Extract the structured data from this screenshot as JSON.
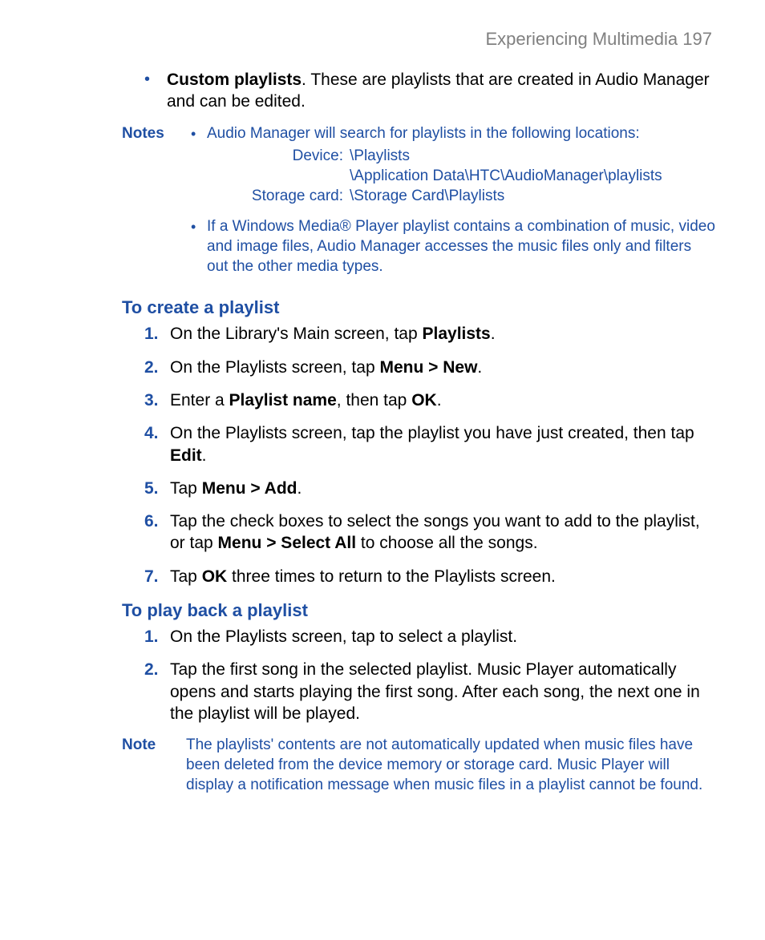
{
  "header": {
    "title": "Experiencing Multimedia  197"
  },
  "intro_bullet": {
    "bold": "Custom playlists",
    "rest": ". These are playlists that are created in Audio Manager and can be edited."
  },
  "notes_label": "Notes",
  "notes": {
    "n1_lead": "Audio Manager will search for playlists in the following locations:",
    "loc": {
      "device_key": "Device:",
      "device_val1": "\\Playlists",
      "device_val2": "\\Application Data\\HTC\\AudioManager\\playlists",
      "card_key": "Storage card:",
      "card_val": "\\Storage Card\\Playlists"
    },
    "n2": "If a Windows Media® Player playlist contains a combination of music, video and image files, Audio Manager accesses the music files only and filters out the other media types."
  },
  "create": {
    "heading": "To create a playlist",
    "s1_a": "On the Library's Main screen, tap ",
    "s1_b": "Playlists",
    "s1_c": ".",
    "s2_a": "On the Playlists screen, tap ",
    "s2_b": "Menu > New",
    "s2_c": ".",
    "s3_a": "Enter a ",
    "s3_b": "Playlist name",
    "s3_c": ", then tap ",
    "s3_d": "OK",
    "s3_e": ".",
    "s4_a": "On the Playlists screen, tap the playlist you have just created, then tap ",
    "s4_b": "Edit",
    "s4_c": ".",
    "s5_a": "Tap ",
    "s5_b": "Menu > Add",
    "s5_c": ".",
    "s6_a": "Tap the check boxes to select the songs you want to add to the playlist, or tap ",
    "s6_b": "Menu > Select All",
    "s6_c": " to choose all the songs.",
    "s7_a": "Tap ",
    "s7_b": "OK",
    "s7_c": " three times to return to the Playlists screen."
  },
  "play": {
    "heading": "To play back a playlist",
    "s1": "On the Playlists screen, tap to select a playlist.",
    "s2": "Tap the first song in the selected playlist. Music Player automatically opens and starts playing the first song. After each song, the next one in the playlist will be played."
  },
  "note2_label": "Note",
  "note2_text": "The playlists' contents are not automatically updated when music files have been deleted from the device memory or storage card. Music Player will display a notification message when music files in a playlist cannot be found.",
  "nums": {
    "n1": "1.",
    "n2": "2.",
    "n3": "3.",
    "n4": "4.",
    "n5": "5.",
    "n6": "6.",
    "n7": "7."
  },
  "bullet": "•"
}
